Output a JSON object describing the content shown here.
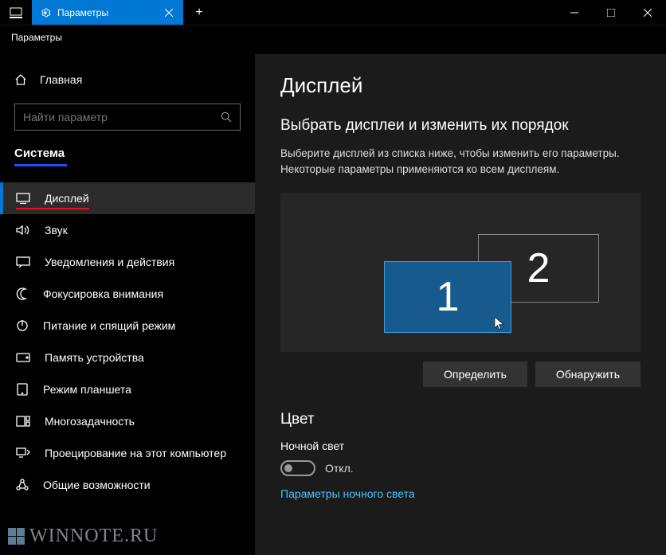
{
  "titlebar": {
    "tab_title": "Параметры",
    "new_tab": "+"
  },
  "breadcrumb": "Параметры",
  "sidebar": {
    "home": "Главная",
    "search_placeholder": "Найти параметр",
    "section": "Система",
    "items": [
      {
        "label": "Дисплей"
      },
      {
        "label": "Звук"
      },
      {
        "label": "Уведомления и действия"
      },
      {
        "label": "Фокусировка внимания"
      },
      {
        "label": "Питание и спящий режим"
      },
      {
        "label": "Память устройства"
      },
      {
        "label": "Режим планшета"
      },
      {
        "label": "Многозадачность"
      },
      {
        "label": "Проецирование на этот компьютер"
      },
      {
        "label": "Общие возможности"
      }
    ]
  },
  "content": {
    "title": "Дисплей",
    "arrange_title": "Выбрать дисплеи и изменить их порядок",
    "arrange_desc": "Выберите дисплей из списка ниже, чтобы изменить его параметры. Некоторые параметры применяются ко всем дисплеям.",
    "monitor1": "1",
    "monitor2": "2",
    "identify_btn": "Определить",
    "detect_btn": "Обнаружить",
    "color_title": "Цвет",
    "night_light_label": "Ночной свет",
    "toggle_state": "Откл.",
    "night_light_link": "Параметры ночного света"
  },
  "watermark": "WINNOTE.RU"
}
